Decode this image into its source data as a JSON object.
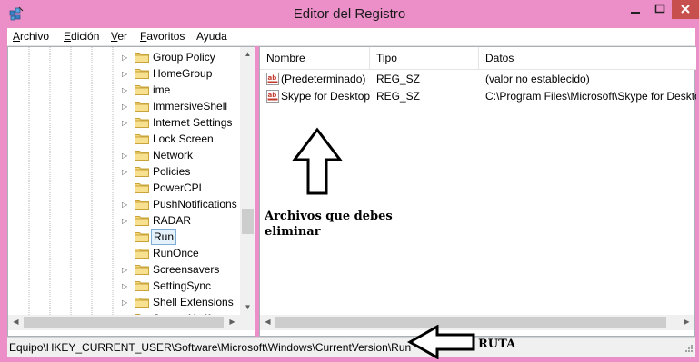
{
  "window": {
    "title": "Editor del Registro",
    "controls": [
      "minimize",
      "maximize",
      "close"
    ],
    "close_color": "#c7504f",
    "frame_color": "#ec8ec8"
  },
  "menubar": {
    "items": [
      {
        "mnemonic": "A",
        "rest": "rchivo"
      },
      {
        "mnemonic": "E",
        "rest": "dición"
      },
      {
        "mnemonic": "V",
        "rest": "er"
      },
      {
        "mnemonic": "F",
        "rest": "avoritos"
      },
      {
        "mnemonic": "",
        "rest": "Ayuda"
      }
    ]
  },
  "tree": {
    "items": [
      {
        "label": "Group Policy",
        "expandable": true
      },
      {
        "label": "HomeGroup",
        "expandable": true
      },
      {
        "label": "ime",
        "expandable": true
      },
      {
        "label": "ImmersiveShell",
        "expandable": true
      },
      {
        "label": "Internet Settings",
        "expandable": true
      },
      {
        "label": "Lock Screen",
        "expandable": false
      },
      {
        "label": "Network",
        "expandable": true
      },
      {
        "label": "Policies",
        "expandable": true
      },
      {
        "label": "PowerCPL",
        "expandable": false
      },
      {
        "label": "PushNotifications",
        "expandable": true
      },
      {
        "label": "RADAR",
        "expandable": true
      },
      {
        "label": "Run",
        "expandable": false,
        "selected": true
      },
      {
        "label": "RunOnce",
        "expandable": false
      },
      {
        "label": "Screensavers",
        "expandable": true
      },
      {
        "label": "SettingSync",
        "expandable": true
      },
      {
        "label": "Shell Extensions",
        "expandable": true
      },
      {
        "label": "StartupNotify",
        "expandable": true
      }
    ]
  },
  "values": {
    "columns": [
      "Nombre",
      "Tipo",
      "Datos"
    ],
    "rows": [
      {
        "name": "(Predeterminado)",
        "type": "REG_SZ",
        "data": "(valor no establecido)",
        "icon": "string-value-icon"
      },
      {
        "name": "Skype for Desktop",
        "type": "REG_SZ",
        "data": "C:\\Program Files\\Microsoft\\Skype for Desktop\\Skype.exe",
        "icon": "string-value-icon"
      }
    ]
  },
  "annotations": {
    "files_note_line1": "Archivos que debes",
    "files_note_line2": "eliminar",
    "path_note": "RUTA"
  },
  "statusbar": {
    "path": "Equipo\\HKEY_CURRENT_USER\\Software\\Microsoft\\Windows\\CurrentVersion\\Run"
  }
}
